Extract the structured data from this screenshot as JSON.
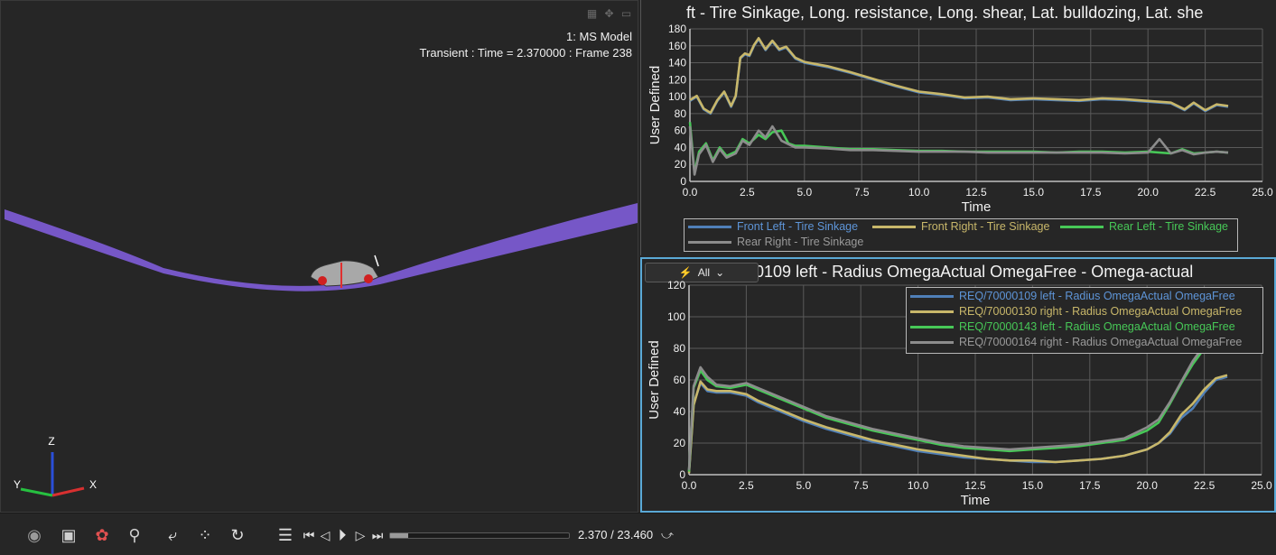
{
  "viewport": {
    "model_label": "1: MS Model",
    "time_label": "Transient : Time = 2.370000 : Frame 238",
    "axis_labels": {
      "z": "Z",
      "y": "Y",
      "x": "X"
    },
    "icons": [
      "map-icon",
      "move-icon",
      "maximize-icon"
    ]
  },
  "toolbar": {
    "time_readout": "2.370 / 23.460",
    "progress": 0.101,
    "icons": [
      "eye-icon",
      "camera-icon",
      "color-palette-icon",
      "search-dropdown-icon",
      "undo-icon",
      "points-icon",
      "refresh-icon",
      "menu-icon",
      "skip-start-icon",
      "step-back-icon",
      "play-icon",
      "step-forward-icon",
      "skip-end-icon",
      "curve-settings-icon"
    ]
  },
  "chart1_title": "ft - Tire Sinkage, Long. resistance, Long. shear, Lat. bulldozing, Lat. she",
  "chart2_title": "000109 left - Radius OmegaActual OmegaFree - Omega-actual",
  "filter_label": "All",
  "chart_data": [
    {
      "type": "line",
      "title": "ft - Tire Sinkage, Long. resistance, Long. shear, Lat. bulldozing, Lat. she",
      "xlabel": "Time",
      "ylabel": "User Defined",
      "xlim": [
        0,
        25
      ],
      "ylim": [
        0,
        180
      ],
      "xticks": [
        "0.0",
        "2.5",
        "5.0",
        "7.5",
        "10.0",
        "12.5",
        "15.0",
        "17.5",
        "20.0",
        "22.5",
        "25.0"
      ],
      "yticks": [
        "0",
        "20",
        "40",
        "60",
        "80",
        "100",
        "120",
        "140",
        "160",
        "180"
      ],
      "grid": true,
      "legend_position": "bottom",
      "series": [
        {
          "name": "Front Left - Tire Sinkage",
          "color": "#4f7fb8",
          "x": [
            0,
            0.3,
            0.6,
            0.9,
            1.2,
            1.5,
            1.8,
            2.0,
            2.2,
            2.4,
            2.6,
            2.8,
            3.0,
            3.3,
            3.6,
            3.9,
            4.2,
            4.6,
            5.0,
            6,
            7,
            8,
            9,
            10,
            11,
            12,
            13,
            14,
            15,
            16,
            17,
            18,
            19,
            20,
            21,
            21.6,
            22,
            22.5,
            23,
            23.5
          ],
          "y": [
            95,
            100,
            85,
            80,
            95,
            105,
            88,
            100,
            145,
            150,
            148,
            160,
            168,
            155,
            165,
            155,
            158,
            145,
            140,
            135,
            128,
            120,
            112,
            105,
            102,
            98,
            99,
            96,
            97,
            96,
            95,
            97,
            96,
            94,
            92,
            84,
            92,
            83,
            90,
            88
          ]
        },
        {
          "name": "Front Right - Tire Sinkage",
          "color": "#c8b76a",
          "x": [
            0,
            0.3,
            0.6,
            0.9,
            1.2,
            1.5,
            1.8,
            2.0,
            2.2,
            2.4,
            2.6,
            2.8,
            3.0,
            3.3,
            3.6,
            3.9,
            4.2,
            4.6,
            5.0,
            6,
            7,
            8,
            9,
            10,
            11,
            12,
            13,
            14,
            15,
            16,
            17,
            18,
            19,
            20,
            21,
            21.6,
            22,
            22.5,
            23,
            23.5
          ],
          "y": [
            96,
            101,
            86,
            81,
            96,
            106,
            89,
            101,
            146,
            151,
            149,
            161,
            169,
            156,
            166,
            156,
            159,
            146,
            141,
            136,
            129,
            121,
            113,
            106,
            103,
            99,
            100,
            97,
            98,
            97,
            96,
            98,
            97,
            95,
            93,
            85,
            93,
            84,
            91,
            89
          ]
        },
        {
          "name": "Rear Left - Tire Sinkage",
          "color": "#47c857",
          "x": [
            0,
            0.2,
            0.4,
            0.7,
            1.0,
            1.3,
            1.6,
            2.0,
            2.3,
            2.6,
            3.0,
            3.3,
            3.6,
            4.0,
            4.3,
            4.6,
            5,
            6,
            7,
            8,
            9,
            10,
            11,
            12,
            13,
            14,
            15,
            16,
            17,
            18,
            19,
            20,
            21,
            21.5,
            22,
            22.5,
            23,
            23.5
          ],
          "y": [
            70,
            10,
            35,
            45,
            25,
            40,
            30,
            35,
            50,
            45,
            55,
            50,
            58,
            60,
            45,
            42,
            42,
            40,
            38,
            38,
            37,
            36,
            36,
            35,
            35,
            35,
            35,
            34,
            35,
            35,
            34,
            35,
            33,
            38,
            33,
            34,
            35,
            34
          ]
        },
        {
          "name": "Rear Right - Tire Sinkage",
          "color": "#8c8c8c",
          "x": [
            0,
            0.2,
            0.4,
            0.7,
            1.0,
            1.3,
            1.6,
            2.0,
            2.3,
            2.6,
            3.0,
            3.3,
            3.6,
            4.0,
            4.3,
            4.6,
            5,
            6,
            7,
            8,
            9,
            10,
            11,
            12,
            13,
            14,
            15,
            16,
            17,
            18,
            19,
            20,
            20.5,
            21,
            21.5,
            22,
            22.5,
            23,
            23.5
          ],
          "y": [
            65,
            8,
            32,
            43,
            23,
            38,
            28,
            33,
            48,
            43,
            60,
            52,
            65,
            48,
            44,
            40,
            40,
            39,
            37,
            37,
            36,
            35,
            35,
            35,
            34,
            34,
            34,
            34,
            34,
            34,
            33,
            34,
            50,
            33,
            37,
            32,
            34,
            35,
            34
          ]
        }
      ]
    },
    {
      "type": "line",
      "title": "000109 left - Radius OmegaActual OmegaFree - Omega-actual",
      "xlabel": "Time",
      "ylabel": "User Defined",
      "xlim": [
        0,
        25
      ],
      "ylim": [
        0,
        120
      ],
      "xticks": [
        "0.0",
        "2.5",
        "5.0",
        "7.5",
        "10.0",
        "12.5",
        "15.0",
        "17.5",
        "20.0",
        "22.5",
        "25.0"
      ],
      "yticks": [
        "0",
        "20",
        "40",
        "60",
        "80",
        "100",
        "120"
      ],
      "grid": true,
      "legend_position": "top-right",
      "series": [
        {
          "name": "REQ/70000109 left - Radius OmegaActual OmegaFree",
          "color": "#4f7fb8",
          "x": [
            0,
            0.2,
            0.5,
            0.8,
            1.2,
            1.8,
            2.5,
            3,
            4,
            5,
            6,
            7,
            8,
            9,
            10,
            11,
            12,
            13,
            14,
            15,
            16,
            17,
            18,
            19,
            20,
            20.5,
            21,
            21.5,
            22,
            22.5,
            23,
            23.5
          ],
          "y": [
            2,
            45,
            58,
            53,
            52,
            52,
            50,
            46,
            40,
            34,
            29,
            25,
            21,
            18,
            15,
            13,
            11,
            10,
            9,
            8,
            8,
            9,
            10,
            12,
            16,
            20,
            26,
            36,
            42,
            52,
            60,
            62
          ]
        },
        {
          "name": "REQ/70000130 right - Radius OmegaActual OmegaFree",
          "color": "#c8b76a",
          "x": [
            0,
            0.2,
            0.5,
            0.8,
            1.2,
            1.8,
            2.5,
            3,
            4,
            5,
            6,
            7,
            8,
            9,
            10,
            11,
            12,
            13,
            14,
            15,
            16,
            17,
            18,
            19,
            20,
            20.5,
            21,
            21.5,
            22,
            22.5,
            23,
            23.5
          ],
          "y": [
            1,
            44,
            59,
            54,
            53,
            53,
            51,
            47,
            41,
            35,
            30,
            26,
            22,
            19,
            16,
            14,
            12,
            10,
            9,
            9,
            8,
            9,
            10,
            12,
            16,
            20,
            27,
            38,
            45,
            54,
            61,
            63
          ]
        },
        {
          "name": "REQ/70000143 left - Radius OmegaActual OmegaFree",
          "color": "#47c857",
          "x": [
            0,
            0.2,
            0.5,
            0.8,
            1.2,
            1.8,
            2.5,
            3,
            4,
            5,
            6,
            7,
            8,
            9,
            10,
            11,
            12,
            13,
            14,
            15,
            16,
            17,
            18,
            19,
            20,
            20.5,
            21,
            21.5,
            22,
            22.5,
            23,
            23.5
          ],
          "y": [
            2,
            55,
            66,
            60,
            56,
            55,
            57,
            54,
            48,
            42,
            36,
            32,
            28,
            25,
            22,
            19,
            17,
            16,
            15,
            16,
            17,
            18,
            20,
            22,
            28,
            33,
            45,
            58,
            70,
            80,
            88,
            92
          ]
        },
        {
          "name": "REQ/70000164 right - Radius OmegaActual OmegaFree",
          "color": "#8c8c8c",
          "x": [
            0,
            0.2,
            0.5,
            0.8,
            1.2,
            1.8,
            2.5,
            3,
            4,
            5,
            6,
            7,
            8,
            9,
            10,
            11,
            12,
            13,
            14,
            15,
            16,
            17,
            18,
            19,
            20,
            20.5,
            21,
            21.5,
            22,
            22.5,
            23,
            23.5
          ],
          "y": [
            3,
            56,
            68,
            62,
            57,
            56,
            58,
            55,
            49,
            43,
            37,
            33,
            29,
            26,
            23,
            20,
            18,
            17,
            16,
            17,
            18,
            19,
            21,
            23,
            30,
            35,
            46,
            59,
            72,
            82,
            90,
            94
          ]
        }
      ]
    }
  ]
}
